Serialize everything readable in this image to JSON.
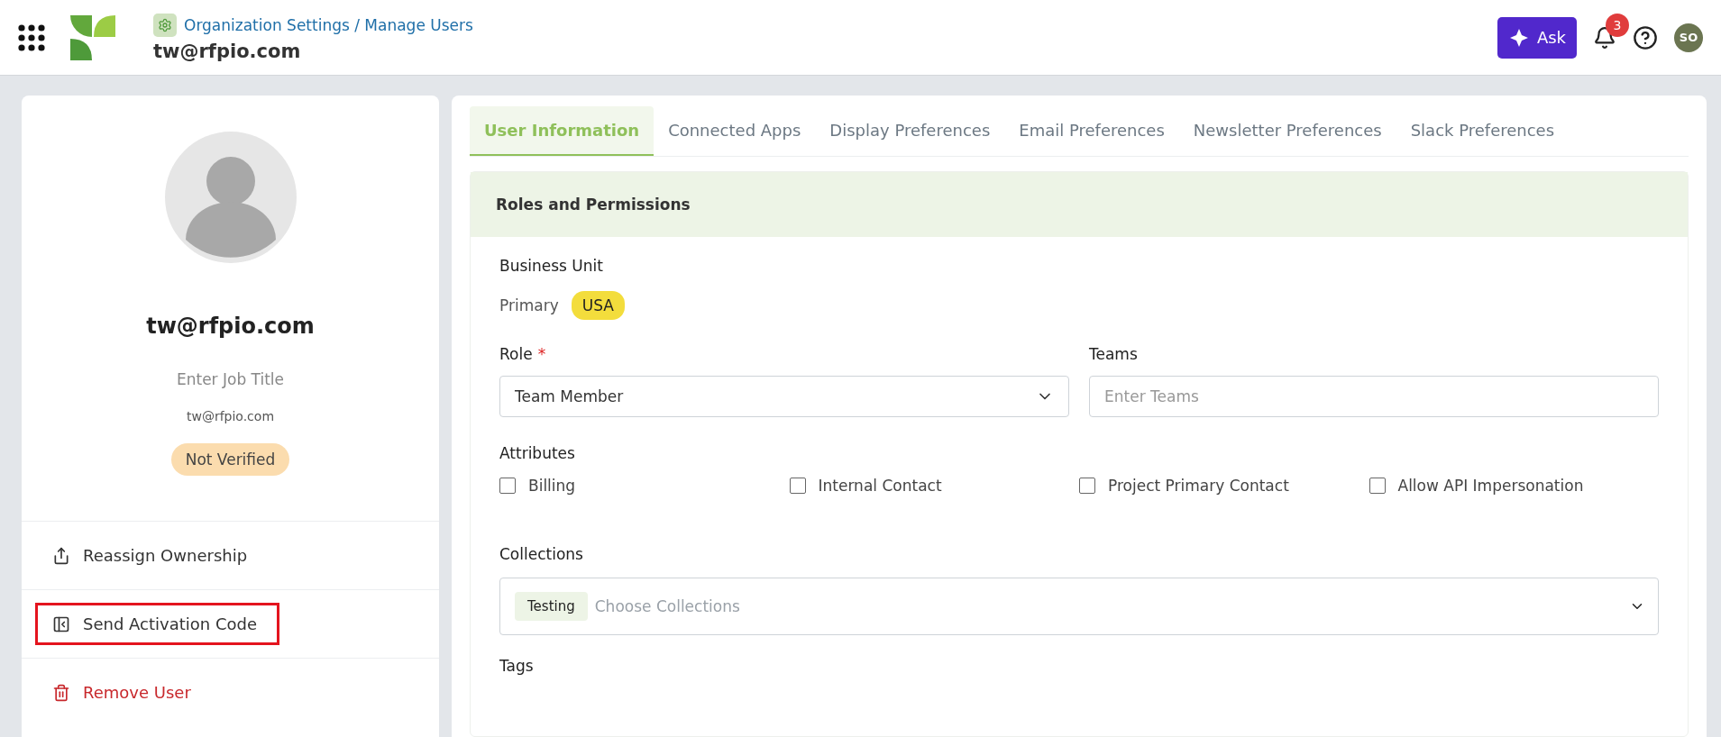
{
  "header": {
    "breadcrumb": "Organization Settings / Manage Users",
    "title": "tw@rfpio.com",
    "ask_label": "Ask",
    "notification_count": "3",
    "avatar_initials": "SO"
  },
  "profile": {
    "name": "tw@rfpio.com",
    "job_title_placeholder": "Enter Job Title",
    "email": "tw@rfpio.com",
    "status": "Not Verified",
    "actions": [
      {
        "kind": "reassign",
        "label": "Reassign Ownership",
        "highlighted": false
      },
      {
        "kind": "activation",
        "label": "Send Activation Code",
        "highlighted": true
      },
      {
        "kind": "remove",
        "label": "Remove User",
        "highlighted": false
      }
    ]
  },
  "tabs": [
    {
      "label": "User Information",
      "selected": true
    },
    {
      "label": "Connected Apps",
      "selected": false
    },
    {
      "label": "Display Preferences",
      "selected": false
    },
    {
      "label": "Email Preferences",
      "selected": false
    },
    {
      "label": "Newsletter Preferences",
      "selected": false
    },
    {
      "label": "Slack Preferences",
      "selected": false
    }
  ],
  "section": {
    "title": "Roles and Permissions",
    "business_unit_label": "Business Unit",
    "primary_label": "Primary",
    "primary_unit": "USA",
    "role_label": "Role",
    "role_required": "*",
    "role_value": "Team Member",
    "teams_label": "Teams",
    "teams_placeholder": "Enter Teams",
    "attributes_label": "Attributes",
    "attributes": [
      {
        "label": "Billing",
        "checked": false
      },
      {
        "label": "Internal Contact",
        "checked": false
      },
      {
        "label": "Project Primary Contact",
        "checked": false
      },
      {
        "label": "Allow API Impersonation",
        "checked": false
      }
    ],
    "collections_label": "Collections",
    "collections_tags": [
      "Testing"
    ],
    "collections_placeholder": "Choose Collections",
    "tags_label": "Tags"
  }
}
